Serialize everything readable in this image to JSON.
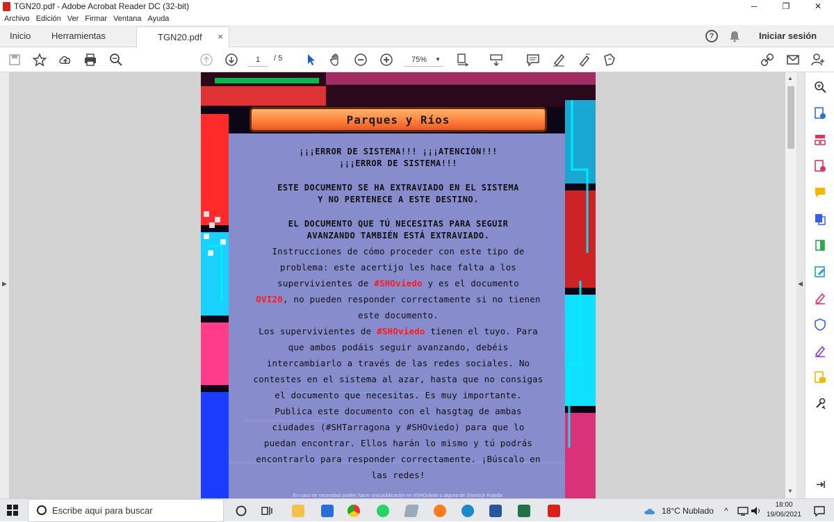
{
  "window": {
    "title": "TGN20.pdf - Adobe Acrobat Reader DC (32-bit)",
    "controls": [
      "─",
      "❐",
      "✕"
    ]
  },
  "menu": [
    "Archivo",
    "Edición",
    "Ver",
    "Firmar",
    "Ventana",
    "Ayuda"
  ],
  "tabs": {
    "home": "Inicio",
    "tools": "Herramientas",
    "document": "TGN20.pdf",
    "close": "×",
    "help": "?",
    "signin": "Iniciar sesión"
  },
  "toolbar": {
    "page_current": "1",
    "page_total": "/ 5",
    "zoom": "75%"
  },
  "document": {
    "header": "Parques y Ríos",
    "warning_lines": [
      "¡¡¡ERROR DE SISTEMA!!! ¡¡¡ATENCIÓN!!!",
      "¡¡¡ERROR DE SISTEMA!!!",
      "ESTE DOCUMENTO SE HA EXTRAVIADO EN EL SISTEMA",
      "Y NO PERTENECE A ESTE DESTINO.",
      "EL DOCUMENTO QUE TÚ NECESITAS PARA SEGUIR",
      "AVANZANDO TAMBIÉN ESTÁ EXTRAVIADO."
    ],
    "body": {
      "l1": "Instrucciones de cómo proceder con este tipo de",
      "l2": "problema: este acertijo les hace falta a los",
      "l3a": "supervivientes de ",
      "l3b": "#SHOviedo",
      "l3c": " y es el documento",
      "l4a": "OVI20",
      "l4b": ", no pueden responder correctamente si no tienen",
      "l5": "este documento.",
      "l6a": "Los supervivientes de ",
      "l6b": "#SHOviedo",
      "l6c": " tienen el tuyo. Para",
      "l7": "que ambos podáis seguir avanzando, debéis",
      "l8": "intercambiarlo a través de las redes sociales. No",
      "l9": "contestes en el sistema al azar, hasta que no consigas",
      "l10": "el documento que necesitas. Es muy importante.",
      "l11": "Publica este documento con el hasgtag de ambas",
      "l12": "ciudades (#SHTarragona y #SHOviedo) para que lo",
      "l13": "puedan encontrar. Ellos harán lo mismo y tú podrás",
      "l14": "encontrarlo para responder correctamente. ¡Búscalo en",
      "l15": "las redes!"
    },
    "footer": "En caso de necesidad podéis hacer una publicación en #SHOviedo o alguna de Sherlock Ruleda"
  },
  "taskbar": {
    "search_placeholder": "Escribe aquí para buscar",
    "weather": "18°C  Nublado",
    "time": "18:00",
    "date": "19/06/2021",
    "tray": "^"
  },
  "colors": {
    "acrobat_red": "#d9201b",
    "hashtag_red": "#ff1a1a",
    "doc_panel": "#8e95d8",
    "banner_orange": "#ff7d3a"
  }
}
